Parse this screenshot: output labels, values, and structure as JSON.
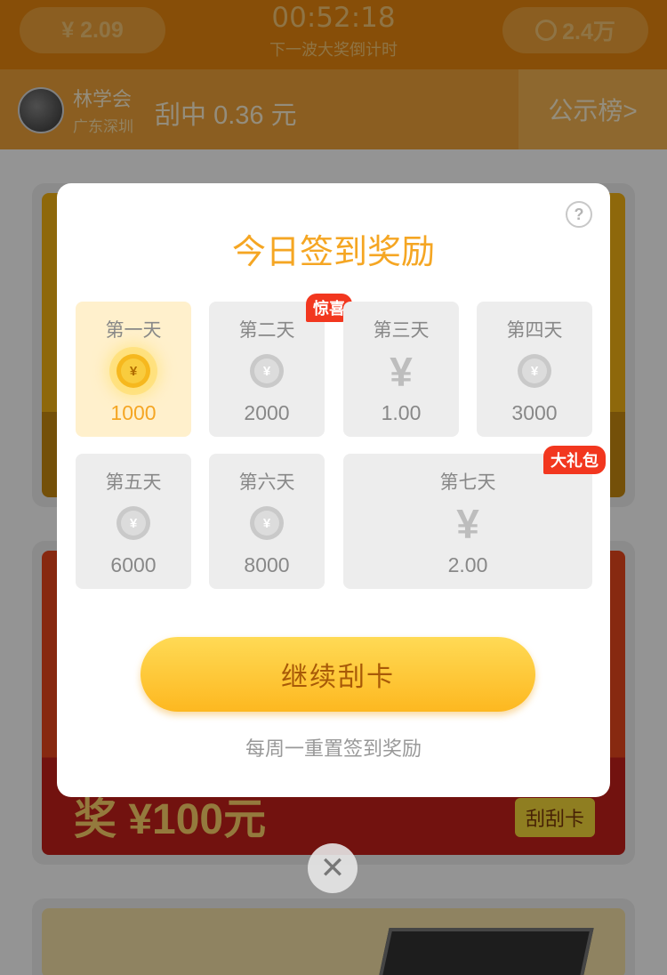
{
  "header": {
    "balance": "¥ 2.09",
    "coins": "2.4万",
    "countdown": "00:52:18",
    "countdown_label": "下一波大奖倒计时"
  },
  "winner": {
    "name": "林学会",
    "location": "广东深圳",
    "prefix": "刮中",
    "amount": "0.36",
    "unit": "元",
    "rank_link": "公示榜>"
  },
  "background_cards": {
    "prize_text": "奖 ¥100元",
    "scratch_tag": "刮刮卡"
  },
  "modal": {
    "title": "今日签到奖励",
    "help": "?",
    "days": [
      {
        "label": "第一天",
        "value": "1000",
        "reward": "coin-gold",
        "state": "today"
      },
      {
        "label": "第二天",
        "value": "2000",
        "reward": "coin",
        "badge": "惊喜"
      },
      {
        "label": "第三天",
        "value": "1.00",
        "reward": "cash"
      },
      {
        "label": "第四天",
        "value": "3000",
        "reward": "coin"
      },
      {
        "label": "第五天",
        "value": "6000",
        "reward": "coin"
      },
      {
        "label": "第六天",
        "value": "8000",
        "reward": "coin"
      },
      {
        "label": "第七天",
        "value": "2.00",
        "reward": "cash",
        "badge": "大礼包"
      }
    ],
    "coin_symbol": "¥",
    "cash_symbol": "¥",
    "cta": "继续刮卡",
    "note": "每周一重置签到奖励",
    "close": "✕"
  },
  "colors": {
    "accent": "#f5a623",
    "badge": "#f2371f",
    "header": "#e8870f"
  }
}
